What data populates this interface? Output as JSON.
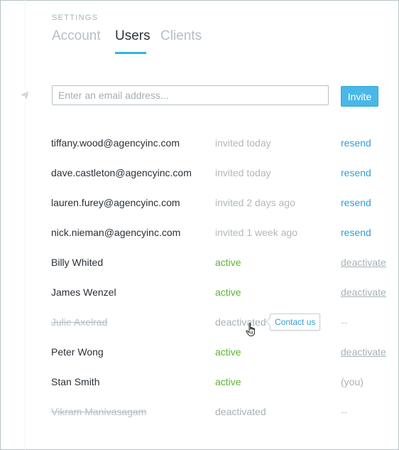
{
  "header": {
    "settings_label": "SETTINGS",
    "tabs": [
      {
        "label": "Account",
        "active": false
      },
      {
        "label": "Users",
        "active": true
      },
      {
        "label": "Clients",
        "active": false
      }
    ]
  },
  "invite_form": {
    "placeholder": "Enter an email address...",
    "value": "",
    "button_label": "Invite"
  },
  "users": [
    {
      "name": "tiffany.wood@agencyinc.com",
      "status": "invited today",
      "status_type": "invited",
      "action": "resend",
      "action_type": "resend",
      "struck": false
    },
    {
      "name": "dave.castleton@agencyinc.com",
      "status": "invited today",
      "status_type": "invited",
      "action": "resend",
      "action_type": "resend",
      "struck": false
    },
    {
      "name": "lauren.furey@agencyinc.com",
      "status": "invited 2 days ago",
      "status_type": "invited",
      "action": "resend",
      "action_type": "resend",
      "struck": false
    },
    {
      "name": "nick.nieman@agencyinc.com",
      "status": "invited 1 week ago",
      "status_type": "invited",
      "action": "resend",
      "action_type": "resend",
      "struck": false
    },
    {
      "name": "Billy Whited",
      "status": "active",
      "status_type": "active",
      "action": "deactivate",
      "action_type": "deactivate",
      "struck": false
    },
    {
      "name": "James Wenzel",
      "status": "active",
      "status_type": "active",
      "action": "deactivate",
      "action_type": "deactivate",
      "struck": false
    },
    {
      "name": "Julie Axelrad",
      "status": "deactivated",
      "status_type": "deactivated",
      "action": "--",
      "action_type": "dash",
      "struck": true
    },
    {
      "name": "Peter Wong",
      "status": "active",
      "status_type": "active",
      "action": "deactivate",
      "action_type": "deactivate",
      "struck": false
    },
    {
      "name": "Stan Smith",
      "status": "active",
      "status_type": "active",
      "action": "(you)",
      "action_type": "you",
      "struck": false
    },
    {
      "name": "Vikram Manivasagam",
      "status": "deactivated",
      "status_type": "deactivated",
      "action": "--",
      "action_type": "dash",
      "struck": true
    }
  ],
  "tooltip": {
    "label": "Contact us"
  },
  "icons": {
    "rail": "paper-plane-icon",
    "cursor": "hand-pointer-icon"
  },
  "colors": {
    "accent": "#2fb5e0",
    "button": "#49b8e8",
    "link": "#2f9fd8",
    "active": "#5cb531"
  }
}
